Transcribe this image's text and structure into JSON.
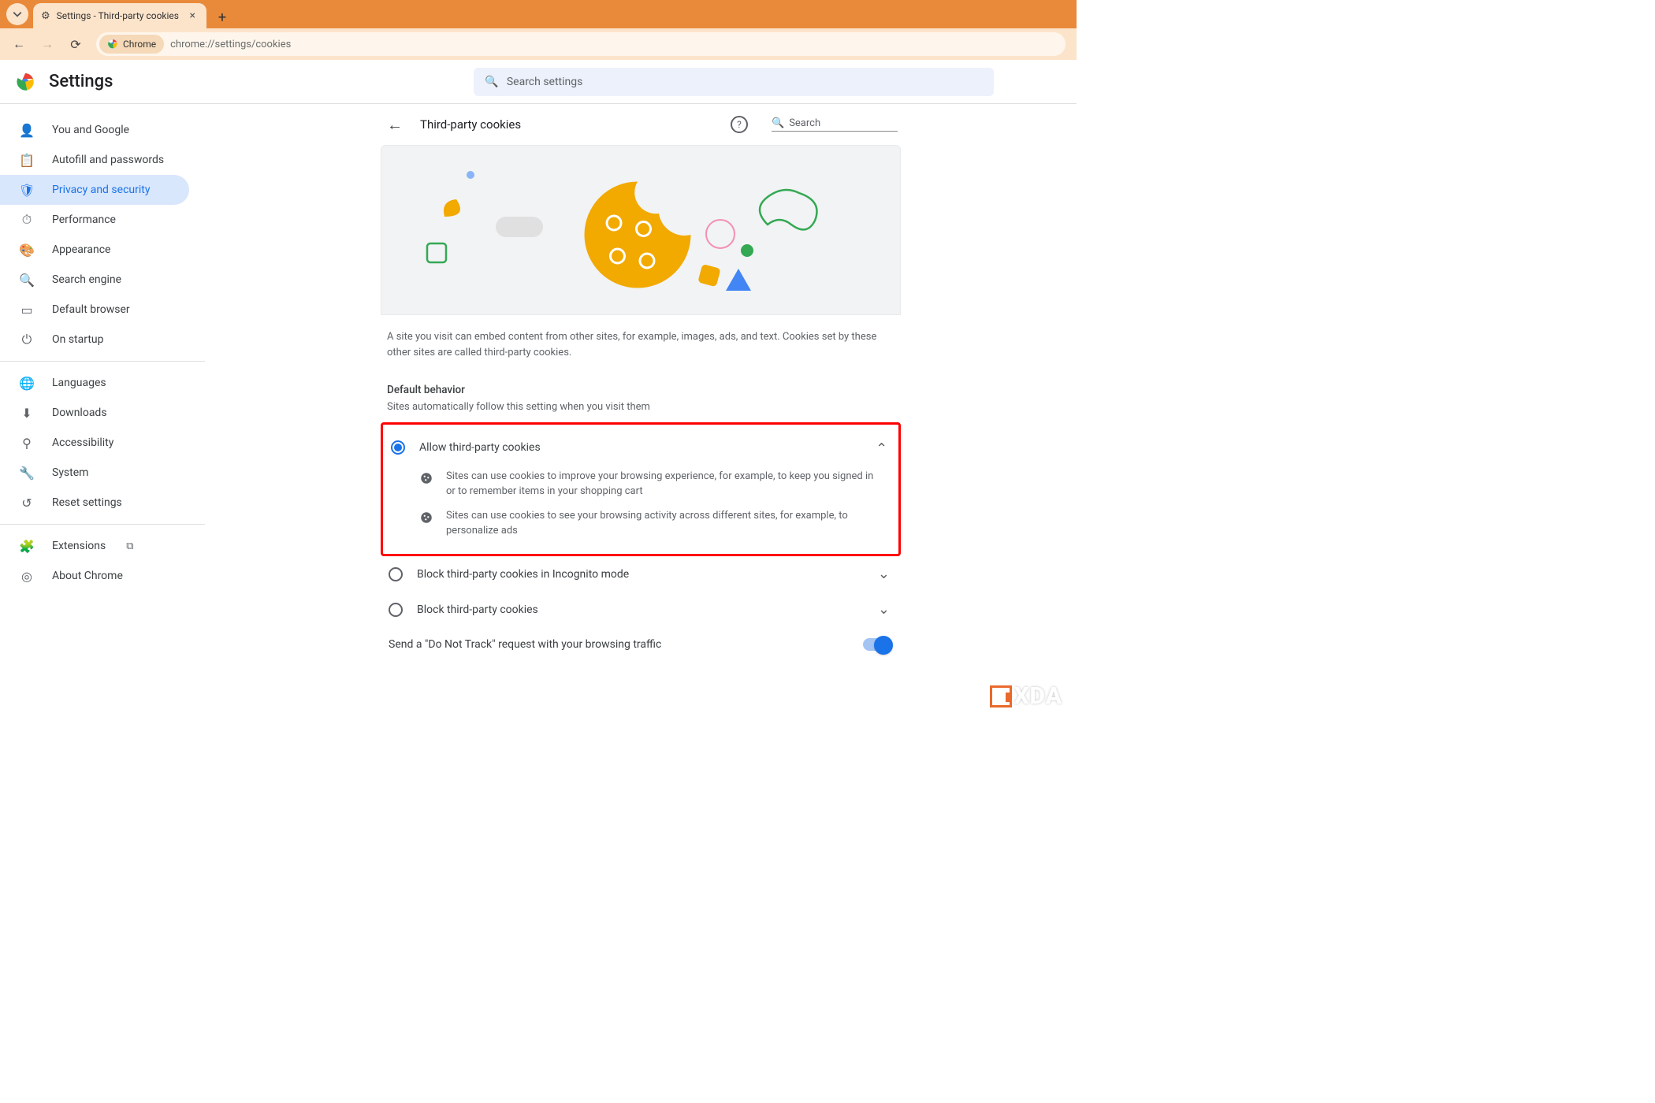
{
  "browser": {
    "tab_title": "Settings - Third-party cookies",
    "chip_label": "Chrome",
    "url": "chrome://settings/cookies"
  },
  "header": {
    "title": "Settings",
    "search_placeholder": "Search settings"
  },
  "sidebar": {
    "items": [
      {
        "label": "You and Google",
        "icon": "person"
      },
      {
        "label": "Autofill and passwords",
        "icon": "clipboard"
      },
      {
        "label": "Privacy and security",
        "icon": "shield",
        "active": true
      },
      {
        "label": "Performance",
        "icon": "speed"
      },
      {
        "label": "Appearance",
        "icon": "palette"
      },
      {
        "label": "Search engine",
        "icon": "search"
      },
      {
        "label": "Default browser",
        "icon": "window"
      },
      {
        "label": "On startup",
        "icon": "power"
      }
    ],
    "items2": [
      {
        "label": "Languages",
        "icon": "globe"
      },
      {
        "label": "Downloads",
        "icon": "download"
      },
      {
        "label": "Accessibility",
        "icon": "accessibility"
      },
      {
        "label": "System",
        "icon": "wrench"
      },
      {
        "label": "Reset settings",
        "icon": "restore"
      }
    ],
    "items3": [
      {
        "label": "Extensions",
        "icon": "puzzle",
        "external": true
      },
      {
        "label": "About Chrome",
        "icon": "chrome"
      }
    ]
  },
  "page": {
    "title": "Third-party cookies",
    "local_search_placeholder": "Search",
    "intro": "A site you visit can embed content from other sites, for example, images, ads, and text. Cookies set by these other sites are called third-party cookies.",
    "default_behavior_label": "Default behavior",
    "default_behavior_sub": "Sites automatically follow this setting when you visit them",
    "option_allow": {
      "label": "Allow third-party cookies",
      "detail1": "Sites can use cookies to improve your browsing experience, for example, to keep you signed in or to remember items in your shopping cart",
      "detail2": "Sites can use cookies to see your browsing activity across different sites, for example, to personalize ads"
    },
    "option_incognito": {
      "label": "Block third-party cookies in Incognito mode"
    },
    "option_block": {
      "label": "Block third-party cookies"
    },
    "dnt_label": "Send a \"Do Not Track\" request with your browsing traffic"
  },
  "watermark": "XDA"
}
